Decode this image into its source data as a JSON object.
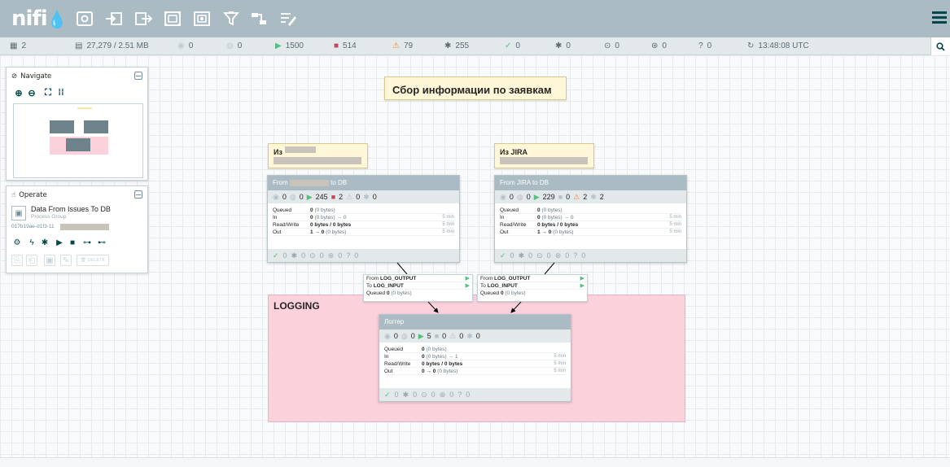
{
  "header": {
    "logo": "nifi",
    "tools": [
      "processor-icon",
      "input-port-icon",
      "output-port-icon",
      "process-group-icon",
      "remote-process-group-icon",
      "funnel-icon",
      "template-icon",
      "label-icon"
    ]
  },
  "status": {
    "threads": "2",
    "queued": "27,279 / 2.51 MB",
    "transmitting": "0",
    "not_transmitting": "0",
    "running": "1500",
    "stopped": "514",
    "invalid": "79",
    "disabled": "255",
    "up_to_date": "0",
    "locally_modified": "0",
    "stale": "0",
    "locally_modified_stale": "0",
    "sync_failure": "0",
    "time": "13:48:08 UTC"
  },
  "navigate": {
    "title": "Navigate"
  },
  "operate": {
    "title": "Operate",
    "component_name": "Data From Issues To DB",
    "component_type": "Process Group",
    "component_id": "017b19ae-d1f3-11",
    "delete_label": "DELETE"
  },
  "canvas": {
    "main_label": "Сбор информации по заявкам",
    "label_left": "Из",
    "label_right": "Из JIRA",
    "logging_title": "LOGGING"
  },
  "groups": {
    "left": {
      "name_prefix": "From",
      "name_suffix": "to DB",
      "transmitting": "0",
      "not_transmitting": "0",
      "running": "245",
      "stopped": "2",
      "invalid": "0",
      "disabled": "0",
      "queued": "0",
      "queued_bytes": "(0 bytes)",
      "in": "0",
      "in_bytes": "(0 bytes) → 0",
      "read_write": "0 bytes / 0 bytes",
      "out": "1 → 0",
      "out_bytes": "(0 bytes)",
      "time": "5 min",
      "up_to_date": "0",
      "locally_modified": "0",
      "stale": "0",
      "modified_stale": "0",
      "sync_failure": "0"
    },
    "right": {
      "name": "From JIRA to DB",
      "transmitting": "0",
      "not_transmitting": "0",
      "running": "229",
      "stopped": "0",
      "invalid": "2",
      "disabled": "2",
      "queued": "0",
      "queued_bytes": "(0 bytes)",
      "in": "0",
      "in_bytes": "(0 bytes) → 0",
      "read_write": "0 bytes / 0 bytes",
      "out": "1 → 0",
      "out_bytes": "(0 bytes)",
      "time": "5 min",
      "up_to_date": "0",
      "locally_modified": "0",
      "stale": "0",
      "modified_stale": "0",
      "sync_failure": "0"
    },
    "logger": {
      "name": "Логгер",
      "transmitting": "0",
      "not_transmitting": "0",
      "running": "5",
      "stopped": "0",
      "invalid": "0",
      "disabled": "0",
      "queued": "0",
      "queued_bytes": "(0 bytes)",
      "in": "0",
      "in_bytes": "(0 bytes) → 1",
      "read_write": "0 bytes / 0 bytes",
      "out": "0 → 0",
      "out_bytes": "(0 bytes)",
      "time": "5 min",
      "up_to_date": "0",
      "locally_modified": "0",
      "stale": "0",
      "modified_stale": "0",
      "sync_failure": "0"
    }
  },
  "connections": {
    "left": {
      "from_label": "From",
      "from": "LOG_OUTPUT",
      "to_label": "To",
      "to": "LOG_INPUT",
      "queued_label": "Queued",
      "queued": "0",
      "queued_bytes": "(0 bytes)"
    },
    "right": {
      "from_label": "From",
      "from": "LOG_OUTPUT",
      "to_label": "To",
      "to": "LOG_INPUT",
      "queued_label": "Queued",
      "queued": "0",
      "queued_bytes": "(0 bytes)"
    }
  },
  "labels": {
    "queued": "Queued",
    "in": "In",
    "read_write": "Read/Write",
    "out": "Out"
  },
  "colors": {
    "header": "#aabbc3",
    "logging_bg": "#fbd1dc",
    "label_bg": "#fff7d7",
    "running": "#52bf7e",
    "stopped": "#c9435c",
    "invalid": "#e98a3a"
  }
}
